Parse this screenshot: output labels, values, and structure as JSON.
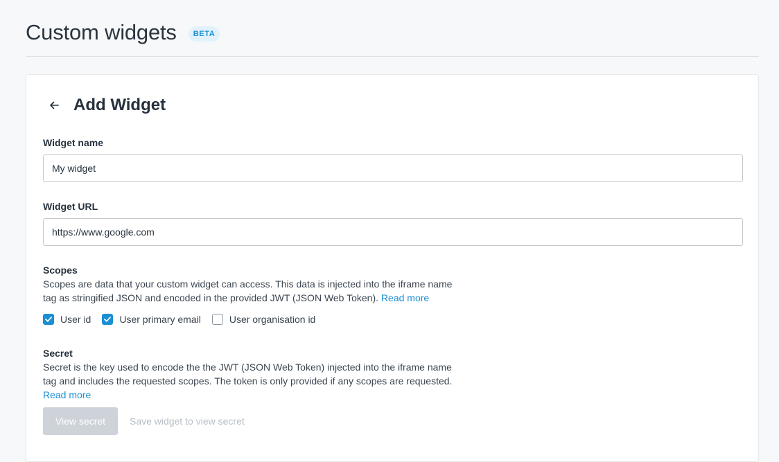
{
  "header": {
    "title": "Custom widgets",
    "badge": "BETA"
  },
  "form": {
    "title": "Add Widget",
    "widget_name": {
      "label": "Widget name",
      "value": "My widget"
    },
    "widget_url": {
      "label": "Widget URL",
      "value": "https://www.google.com"
    },
    "scopes": {
      "label": "Scopes",
      "description": "Scopes are data that your custom widget can access. This data is injected into the iframe name tag as stringified JSON and encoded in the provided JWT (JSON Web Token).",
      "read_more": "Read more",
      "options": [
        {
          "label": "User id",
          "checked": true
        },
        {
          "label": "User primary email",
          "checked": true
        },
        {
          "label": "User organisation id",
          "checked": false
        }
      ]
    },
    "secret": {
      "label": "Secret",
      "description": "Secret is the key used to encode the the JWT (JSON Web Token) injected into the iframe name tag and includes the requested scopes. The token is only provided if any scopes are requested.",
      "read_more": "Read more",
      "view_button": "View secret",
      "hint": "Save widget to view secret"
    }
  },
  "colors": {
    "accent": "#1a8fd3",
    "disabled_button": "#cdd3d9"
  }
}
